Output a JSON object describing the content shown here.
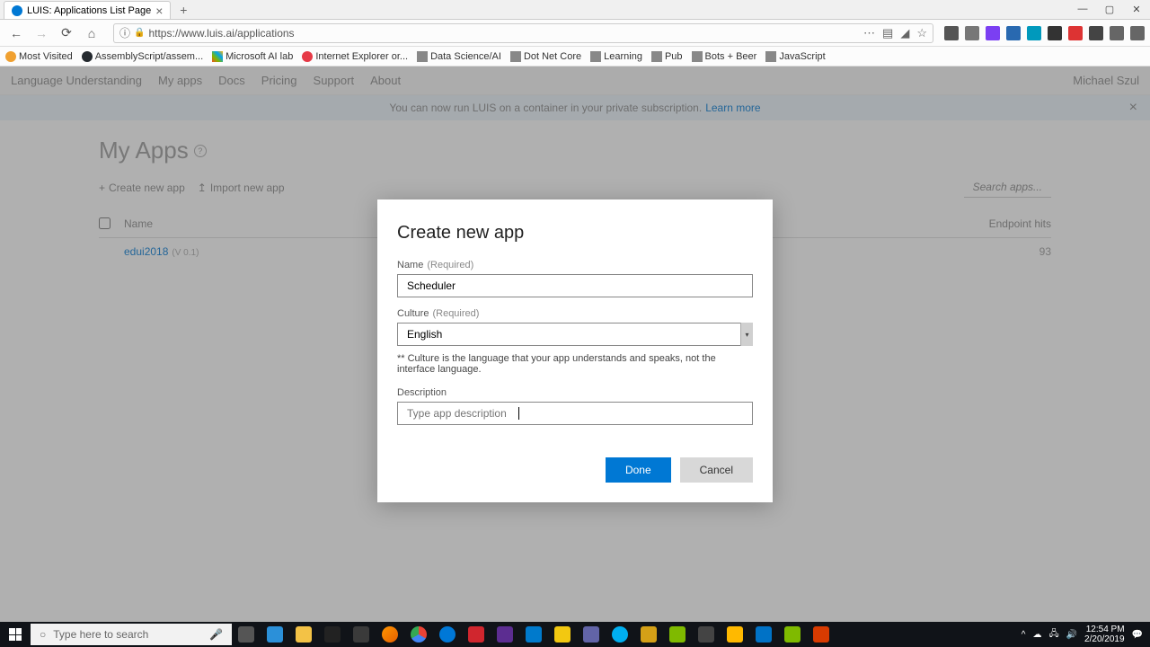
{
  "browser": {
    "tab_title": "LUIS: Applications List Page",
    "url": "https://www.luis.ai/applications",
    "bookmarks": [
      {
        "label": "Most Visited",
        "icon": "star"
      },
      {
        "label": "AssemblyScript/assem...",
        "icon": "gh"
      },
      {
        "label": "Microsoft AI lab",
        "icon": "ms"
      },
      {
        "label": "Internet Explorer or...",
        "icon": "heart"
      },
      {
        "label": "Data Science/AI",
        "icon": "folder"
      },
      {
        "label": "Dot Net Core",
        "icon": "folder"
      },
      {
        "label": "Learning",
        "icon": "folder"
      },
      {
        "label": "Pub",
        "icon": "folder"
      },
      {
        "label": "Bots + Beer",
        "icon": "folder"
      },
      {
        "label": "JavaScript",
        "icon": "folder"
      }
    ]
  },
  "luis_nav": {
    "brand": "Language Understanding",
    "items": [
      "My apps",
      "Docs",
      "Pricing",
      "Support",
      "About"
    ],
    "user": "Michael Szul"
  },
  "banner": {
    "text": "You can now run LUIS on a container in your private subscription.",
    "learn": "Learn more"
  },
  "page": {
    "title": "My Apps",
    "actions": {
      "create": "Create new app",
      "import": "Import new app",
      "search_placeholder": "Search apps..."
    },
    "columns": {
      "name": "Name",
      "hits": "Endpoint hits"
    },
    "row": {
      "name": "edui2018",
      "version": "(V 0.1)",
      "hits": "93"
    }
  },
  "modal": {
    "title": "Create new app",
    "name_label": "Name",
    "required": "(Required)",
    "name_value": "Scheduler",
    "culture_label": "Culture",
    "culture_value": "English",
    "culture_help": "** Culture is the language that your app understands and speaks, not the interface language.",
    "desc_label": "Description",
    "desc_placeholder": "Type app description",
    "done": "Done",
    "cancel": "Cancel"
  },
  "taskbar": {
    "search_placeholder": "Type here to search",
    "time": "12:54 PM",
    "date": "2/20/2019"
  }
}
